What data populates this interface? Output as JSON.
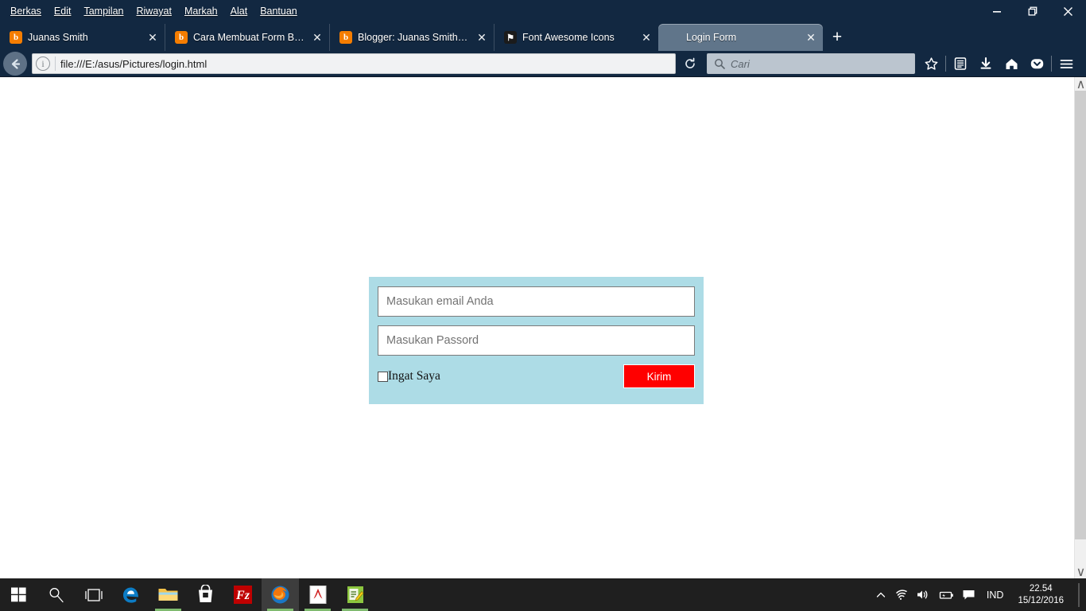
{
  "window": {
    "menus": [
      {
        "label": "Berkas",
        "accel": "B"
      },
      {
        "label": "Edit",
        "accel": "E"
      },
      {
        "label": "Tampilan",
        "accel": "T"
      },
      {
        "label": "Riwayat",
        "accel": "R"
      },
      {
        "label": "Markah",
        "accel": "M"
      },
      {
        "label": "Alat",
        "accel": "A"
      },
      {
        "label": "Bantuan",
        "accel": "n"
      }
    ],
    "controls": {
      "minimize": "minimize-icon",
      "restore": "restore-icon",
      "close": "close-icon"
    }
  },
  "tabs": [
    {
      "title": "Juanas Smith",
      "favicon": "blogger-icon",
      "favicon_letter": "b",
      "active": false,
      "close_label": "✕"
    },
    {
      "title": "Cara Membuat Form Bead...",
      "favicon": "blogger-icon",
      "favicon_letter": "b",
      "active": false,
      "close_label": "✕"
    },
    {
      "title": "Blogger: Juanas Smith - T...",
      "favicon": "blogger-icon",
      "favicon_letter": "b",
      "active": false,
      "close_label": "✕"
    },
    {
      "title": "Font Awesome Icons",
      "favicon": "flag-icon",
      "favicon_letter": "⚑",
      "active": false,
      "close_label": "✕"
    },
    {
      "title": "Login Form",
      "favicon": "none",
      "favicon_letter": "",
      "active": true,
      "close_label": "✕"
    }
  ],
  "newtab_label": "+",
  "navbar": {
    "back_icon": "back-arrow-icon",
    "info_icon": "i",
    "url": "file:///E:/asus/Pictures/login.html",
    "reload_icon": "reload-icon",
    "search_placeholder": "Cari",
    "search_value": "",
    "icons": [
      "bookmark-star-icon",
      "library-icon",
      "downloads-icon",
      "home-icon",
      "pocket-icon",
      "menu-hamburger-icon"
    ]
  },
  "page": {
    "title": "Login Form",
    "form": {
      "email_placeholder": "Masukan email Anda",
      "email_value": "",
      "password_placeholder": "Masukan Passord",
      "password_value": "",
      "remember_label": "Ingat Saya",
      "remember_checked": false,
      "submit_label": "Kirim",
      "panel_color": "#addce6",
      "submit_color": "#ff0000"
    }
  },
  "scrollbar": {
    "up_arrow": "∧",
    "down_arrow": "∨"
  },
  "taskbar": {
    "items": [
      {
        "name": "start-button",
        "label": "",
        "active": false,
        "running": false
      },
      {
        "name": "search-button",
        "label": "",
        "active": false,
        "running": false
      },
      {
        "name": "task-view-button",
        "label": "",
        "active": false,
        "running": false
      },
      {
        "name": "edge-icon",
        "label": "",
        "active": false,
        "running": false
      },
      {
        "name": "file-explorer-icon",
        "label": "",
        "active": false,
        "running": true
      },
      {
        "name": "microsoft-store-icon",
        "label": "",
        "active": false,
        "running": false
      },
      {
        "name": "filezilla-icon",
        "label": "FZ",
        "active": false,
        "running": false
      },
      {
        "name": "firefox-icon",
        "label": "",
        "active": true,
        "running": true
      },
      {
        "name": "adobe-reader-icon",
        "label": "",
        "active": false,
        "running": true
      },
      {
        "name": "notepad-editor-icon",
        "label": "",
        "active": false,
        "running": true
      }
    ],
    "tray": {
      "chevron": "∧",
      "language": "IND",
      "time": "22.54",
      "date": "15/12/2016"
    }
  }
}
